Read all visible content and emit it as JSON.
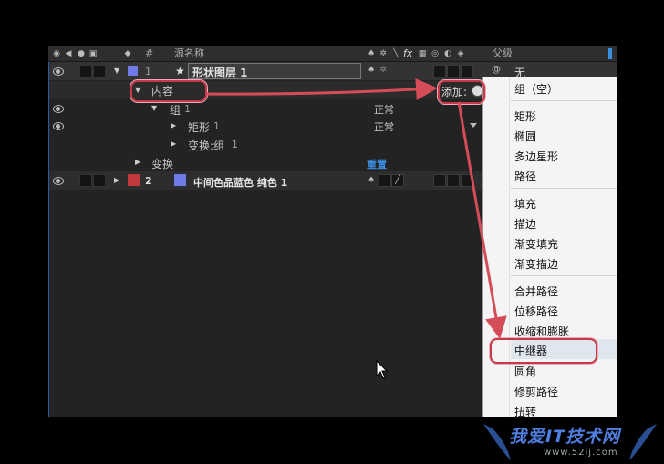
{
  "header": {
    "hash": "#",
    "source_name": "源名称",
    "fx": "fx",
    "parent": "父级"
  },
  "layers": [
    {
      "num": "1",
      "name": "形状图层 1",
      "label_color": "#6f7be8",
      "parent": "无"
    },
    {
      "num": "2",
      "name": "中间色品蓝色 纯色 1",
      "label_color": "#c0393b"
    }
  ],
  "rows": {
    "contents": "内容",
    "add_label": "添加:",
    "group": "组",
    "group_num": "1",
    "group_mode": "正常",
    "rect": "矩形",
    "rect_num": "1",
    "rect_mode": "正常",
    "transform_group": "变换:组",
    "transform_group_num": "1",
    "transform": "变换",
    "reset": "重置"
  },
  "menu": {
    "items": [
      "组（空）",
      "矩形",
      "椭圆",
      "多边星形",
      "路径",
      "填充",
      "描边",
      "渐变填充",
      "渐变描边",
      "合并路径",
      "位移路径",
      "收缩和膨胀",
      "中继器",
      "圆角",
      "修剪路径",
      "扭转"
    ],
    "highlighted": "中继器"
  },
  "watermark": {
    "text": "我爱IT技术网",
    "url": "www.52ij.com"
  },
  "colors": {
    "accent_red": "#c43a46",
    "reset_blue": "#3b8fe0"
  }
}
